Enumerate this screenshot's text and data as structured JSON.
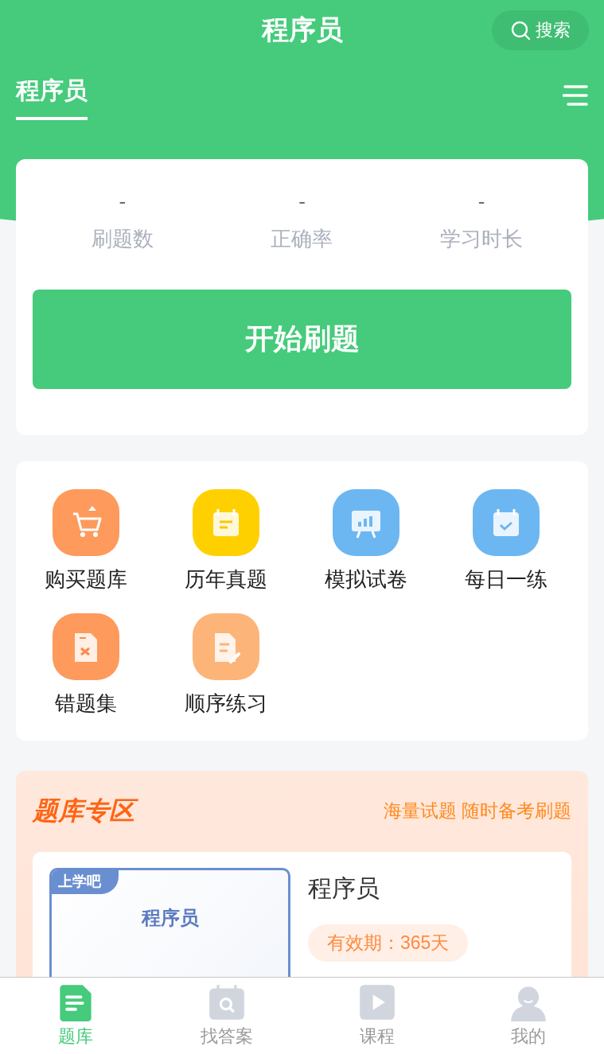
{
  "header": {
    "title": "程序员",
    "search": {
      "label": "搜索"
    }
  },
  "tabs": [
    {
      "label": "程序员",
      "selected": true
    }
  ],
  "stats": [
    {
      "value": "-",
      "label": "刷题数"
    },
    {
      "value": "-",
      "label": "正确率"
    },
    {
      "value": "-",
      "label": "学习时长"
    }
  ],
  "start_button": {
    "label": "开始刷题"
  },
  "features": [
    {
      "label": "购买题库",
      "color": "#fd9a5c"
    },
    {
      "label": "历年真题",
      "color": "#ffd000"
    },
    {
      "label": "模拟试卷",
      "color": "#6cb7f2"
    },
    {
      "label": "每日一练",
      "color": "#6cb7f2"
    },
    {
      "label": "错题集",
      "color": "#fd9a5c"
    },
    {
      "label": "顺序练习",
      "color": "#fdb478"
    }
  ],
  "zone": {
    "title": "题库专区",
    "subtitle": "海量试题 随时备考刷题",
    "products": [
      {
        "cover_brand": "上学吧",
        "cover_title": "程序员",
        "title": "程序员",
        "validity": "有效期：365天"
      }
    ]
  },
  "bottom_nav": [
    {
      "label": "题库",
      "selected": true
    },
    {
      "label": "找答案",
      "selected": false
    },
    {
      "label": "课程",
      "selected": false
    },
    {
      "label": "我的",
      "selected": false
    }
  ]
}
